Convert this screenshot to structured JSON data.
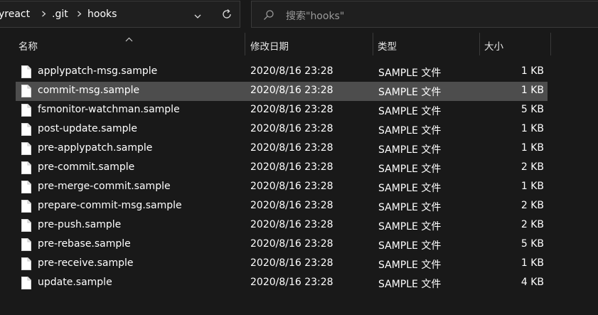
{
  "breadcrumb": {
    "items": [
      "yreact",
      ".git",
      "hooks"
    ]
  },
  "search": {
    "placeholder": "搜索\"hooks\""
  },
  "columns": {
    "name": "名称",
    "date": "修改日期",
    "type": "类型",
    "size": "大小"
  },
  "files": [
    {
      "name": "applypatch-msg.sample",
      "date": "2020/8/16 23:28",
      "type": "SAMPLE 文件",
      "size": "1 KB"
    },
    {
      "name": "commit-msg.sample",
      "date": "2020/8/16 23:28",
      "type": "SAMPLE 文件",
      "size": "1 KB",
      "selected": true
    },
    {
      "name": "fsmonitor-watchman.sample",
      "date": "2020/8/16 23:28",
      "type": "SAMPLE 文件",
      "size": "5 KB"
    },
    {
      "name": "post-update.sample",
      "date": "2020/8/16 23:28",
      "type": "SAMPLE 文件",
      "size": "1 KB"
    },
    {
      "name": "pre-applypatch.sample",
      "date": "2020/8/16 23:28",
      "type": "SAMPLE 文件",
      "size": "1 KB"
    },
    {
      "name": "pre-commit.sample",
      "date": "2020/8/16 23:28",
      "type": "SAMPLE 文件",
      "size": "2 KB"
    },
    {
      "name": "pre-merge-commit.sample",
      "date": "2020/8/16 23:28",
      "type": "SAMPLE 文件",
      "size": "1 KB"
    },
    {
      "name": "prepare-commit-msg.sample",
      "date": "2020/8/16 23:28",
      "type": "SAMPLE 文件",
      "size": "2 KB"
    },
    {
      "name": "pre-push.sample",
      "date": "2020/8/16 23:28",
      "type": "SAMPLE 文件",
      "size": "2 KB"
    },
    {
      "name": "pre-rebase.sample",
      "date": "2020/8/16 23:28",
      "type": "SAMPLE 文件",
      "size": "5 KB"
    },
    {
      "name": "pre-receive.sample",
      "date": "2020/8/16 23:28",
      "type": "SAMPLE 文件",
      "size": "1 KB"
    },
    {
      "name": "update.sample",
      "date": "2020/8/16 23:28",
      "type": "SAMPLE 文件",
      "size": "4 KB"
    }
  ],
  "colors": {
    "background": "#191919",
    "selected_row": "#4d4d4d",
    "text": "#ffffff"
  }
}
